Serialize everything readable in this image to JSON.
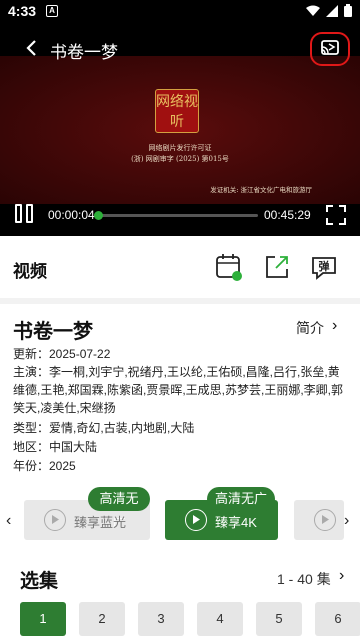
{
  "status_bar": {
    "time": "4:33",
    "notif_icon": "a-icon"
  },
  "player": {
    "title": "书卷一梦",
    "seal_text": "网络视听",
    "license_line1": "网络剧片发行许可证",
    "license_line2": "(浙) 网剧审字 (2025) 第015号",
    "issuer": "发证机关: 浙江省文化广电和旅游厅",
    "current_time": "00:00:04",
    "total_time": "00:45:29",
    "progress_percent": 0.15
  },
  "video_section": {
    "title": "视频",
    "danmaku_label": "弹"
  },
  "info": {
    "title": "书卷一梦",
    "intro_label": "简介",
    "update": "更新：2025-07-22",
    "cast_line1": "主演：李一桐,刘宇宁,祝绪丹,王以纶,王佑硕,昌隆,吕行,张垒,黄",
    "cast_line2": "维德,王艳,郑国霖,陈紫函,贾景晖,王成思,苏梦芸,王丽娜,李卿,郭",
    "cast_line3": "笑天,凌美仕,宋继扬",
    "genre": "类型：爱情,奇幻,古装,内地剧,大陆",
    "region": "地区：中国大陆",
    "year": "年份：2025"
  },
  "sources": [
    {
      "badge": "高清无广",
      "label": "臻享蓝光",
      "active": false
    },
    {
      "badge": "高清无广",
      "label": "臻享4K",
      "active": true
    }
  ],
  "episodes": {
    "title": "选集",
    "range": "1 - 40 集",
    "items": [
      "1",
      "2",
      "3",
      "4",
      "5",
      "6"
    ],
    "selected": "1"
  },
  "colors": {
    "accent": "#2e7d32",
    "cast_highlight": "#e01818"
  }
}
